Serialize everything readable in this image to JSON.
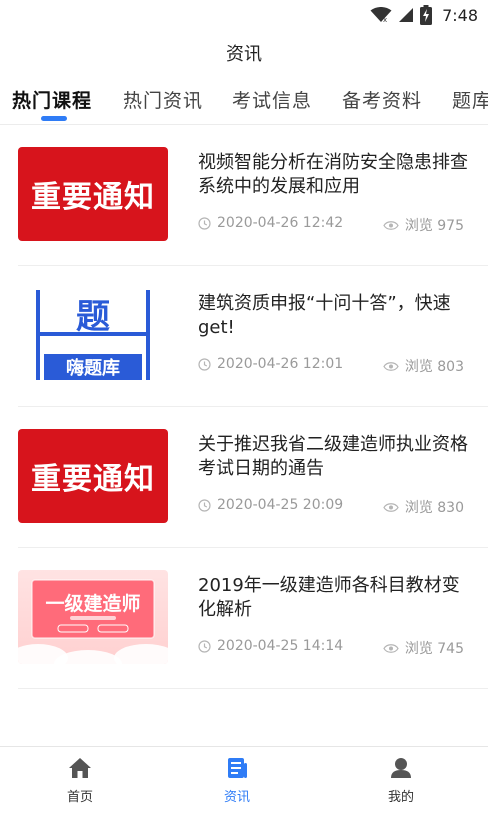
{
  "status_bar": {
    "time": "7:48",
    "icons": [
      "wifi-icon",
      "signal-icon",
      "battery-charging-icon"
    ]
  },
  "header": {
    "title": "资讯"
  },
  "tabs": [
    {
      "label": "热门课程",
      "active": true
    },
    {
      "label": "热门资讯",
      "active": false
    },
    {
      "label": "考试信息",
      "active": false
    },
    {
      "label": "备考资料",
      "active": false
    },
    {
      "label": "题库",
      "active": false
    }
  ],
  "articles": [
    {
      "title": "视频智能分析在消防安全隐患排查系统中的发展和应用",
      "thumbnail_text": "重要通知",
      "time": "2020-04-26 12:42",
      "views": "浏览 975"
    },
    {
      "title": "建筑资质申报“十问十答”，快速get!",
      "thumbnail_text": "嗨题库",
      "thumbnail_glyph": "题",
      "time": "2020-04-26 12:01",
      "views": "浏览 803"
    },
    {
      "title": "关于推迟我省二级建造师执业资格考试日期的通告",
      "thumbnail_text": "重要通知",
      "time": "2020-04-25 20:09",
      "views": "浏览 830"
    },
    {
      "title": "2019年一级建造师各科目教材变化解析",
      "thumbnail_text": "一级建造师",
      "time": "2020-04-25 14:14",
      "views": "浏览 745"
    }
  ],
  "bottom_nav": [
    {
      "label": "首页",
      "icon": "home-icon",
      "active": false
    },
    {
      "label": "资讯",
      "icon": "news-icon",
      "active": true
    },
    {
      "label": "我的",
      "icon": "profile-icon",
      "active": false
    }
  ],
  "colors": {
    "accent": "#2f7cf6",
    "notice_red": "#d7141c",
    "quiz_blue": "#2a5bd7",
    "meta_gray": "#9a9a9a"
  }
}
